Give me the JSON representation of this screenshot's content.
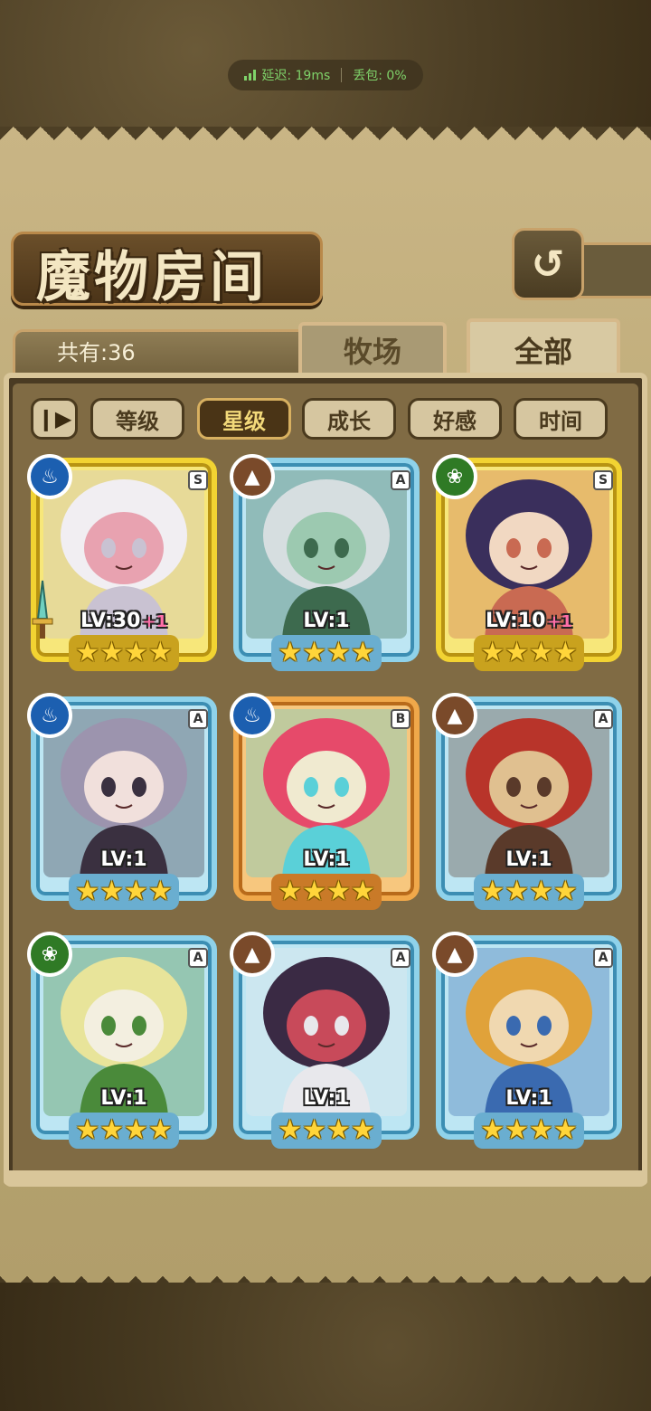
{
  "network": {
    "latency_label": "延迟: 19ms",
    "loss_label": "丢包: 0%"
  },
  "header": {
    "title": "魔物房间",
    "back_icon": "back-arrow-icon"
  },
  "summary": {
    "count_label": "共有:36"
  },
  "tabs": [
    {
      "label": "牧场",
      "active": false
    },
    {
      "label": "全部",
      "active": true
    }
  ],
  "sort": {
    "toggle_icon": "sort-order-icon",
    "options": [
      {
        "label": "等级",
        "active": false
      },
      {
        "label": "星级",
        "active": true
      },
      {
        "label": "成长",
        "active": false
      },
      {
        "label": "好感",
        "active": false
      },
      {
        "label": "时间",
        "active": false
      }
    ]
  },
  "colors": {
    "water": "#1c5fb0",
    "earth": "#7a4a2a",
    "wood": "#2f7a25",
    "rank_S": "#f2d332",
    "rank_A": "#8fd2ea",
    "rank_B": "#f0a84a",
    "star": "#ffd53a"
  },
  "monsters": [
    {
      "element": "water",
      "rank": "S",
      "level": "LV:30",
      "bonus": "+1",
      "stars": 4,
      "equipped_weapon": true,
      "palette": [
        "#f1eef2",
        "#c9c2d2",
        "#e8a2b0"
      ]
    },
    {
      "element": "earth",
      "rank": "A",
      "level": "LV:1",
      "bonus": "",
      "stars": 4,
      "equipped_weapon": false,
      "palette": [
        "#d6dee0",
        "#3d6a4e",
        "#9cc9b0"
      ]
    },
    {
      "element": "wood",
      "rank": "S",
      "level": "LV:10",
      "bonus": "+1",
      "stars": 4,
      "equipped_weapon": false,
      "palette": [
        "#3a2f5c",
        "#c96a52",
        "#f1d8c2"
      ]
    },
    {
      "element": "water",
      "rank": "A",
      "level": "LV:1",
      "bonus": "",
      "stars": 4,
      "equipped_weapon": false,
      "palette": [
        "#9c94ae",
        "#3a3040",
        "#f1e0dc"
      ]
    },
    {
      "element": "water",
      "rank": "B",
      "level": "LV:1",
      "bonus": "",
      "stars": 4,
      "equipped_weapon": false,
      "palette": [
        "#e64a6a",
        "#5ad0d8",
        "#f0ead0"
      ]
    },
    {
      "element": "earth",
      "rank": "A",
      "level": "LV:1",
      "bonus": "",
      "stars": 4,
      "equipped_weapon": false,
      "palette": [
        "#b8342a",
        "#5a3a2a",
        "#e0c090"
      ]
    },
    {
      "element": "wood",
      "rank": "A",
      "level": "LV:1",
      "bonus": "",
      "stars": 4,
      "equipped_weapon": false,
      "palette": [
        "#e8e49a",
        "#4a8a3a",
        "#f3efe0"
      ]
    },
    {
      "element": "earth",
      "rank": "A",
      "level": "LV:1",
      "bonus": "",
      "stars": 4,
      "equipped_weapon": false,
      "palette": [
        "#3a2a44",
        "#e8e8ec",
        "#c84a5a"
      ]
    },
    {
      "element": "earth",
      "rank": "A",
      "level": "LV:1",
      "bonus": "",
      "stars": 4,
      "equipped_weapon": false,
      "palette": [
        "#e0a23a",
        "#3a6ab0",
        "#f0d8b0"
      ]
    }
  ]
}
